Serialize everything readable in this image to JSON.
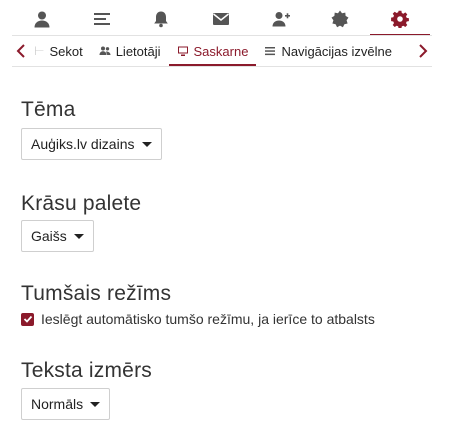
{
  "top_nav": {
    "icons": [
      "user-icon",
      "list-icon",
      "bell-icon",
      "envelope-icon",
      "add-user-icon",
      "badge-icon",
      "gear-icon"
    ],
    "active_index": 6,
    "accent": "#8b1a2b",
    "icon_color": "#555555"
  },
  "sub_tabs": {
    "partial_left": "Sekot",
    "items": [
      {
        "label": "Lietotāji",
        "icon": "users-icon"
      },
      {
        "label": "Saskarne",
        "icon": "monitor-icon",
        "active": true
      },
      {
        "label": "Navigācijas izvēlne",
        "icon": "menu-icon"
      }
    ]
  },
  "settings": {
    "theme": {
      "heading": "Tēma",
      "value": "Auģiks.lv dizains"
    },
    "palette": {
      "heading": "Krāsu palete",
      "value": "Gaišs"
    },
    "dark_mode": {
      "heading": "Tumšais režīms",
      "checkbox_label": "Ieslēgt automātisko tumšo režīmu, ja ierīce to atbalsts",
      "checked": true
    },
    "text_size": {
      "heading": "Teksta izmērs",
      "value": "Normāls"
    }
  }
}
